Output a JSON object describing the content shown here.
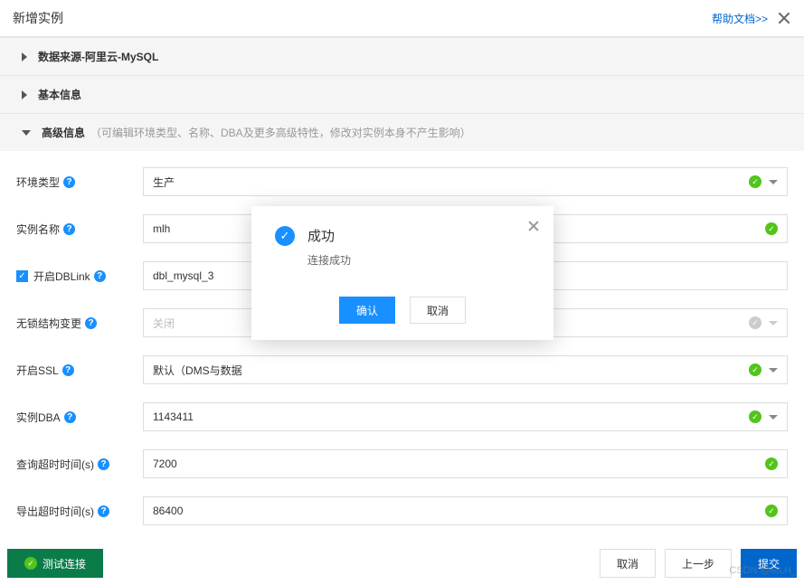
{
  "header": {
    "title": "新增实例",
    "help_link": "帮助文档>>"
  },
  "sections": {
    "datasource": {
      "label": "数据来源-阿里云-MySQL"
    },
    "basic": {
      "label": "基本信息"
    },
    "advanced": {
      "label": "高级信息",
      "sub": "（可编辑环境类型、名称、DBA及更多高级特性，修改对实例本身不产生影响）"
    }
  },
  "form": {
    "env_type": {
      "label": "环境类型",
      "value": "生产"
    },
    "instance_name": {
      "label": "实例名称",
      "value": "mlh"
    },
    "dblink": {
      "label": "开启DBLink",
      "value": "dbl_mysql_3"
    },
    "lockfree": {
      "label": "无锁结构变更",
      "value": "关闭"
    },
    "ssl": {
      "label": "开启SSL",
      "value": "默认（DMS与数据"
    },
    "dba": {
      "label": "实例DBA",
      "value": "1143411"
    },
    "query_timeout": {
      "label": "查询超时时间(s)",
      "value": "7200"
    },
    "export_timeout": {
      "label": "导出超时时间(s)",
      "value": "86400"
    }
  },
  "footer": {
    "test": "测试连接",
    "cancel": "取消",
    "prev": "上一步",
    "submit": "提交"
  },
  "modal": {
    "title": "成功",
    "message": "连接成功",
    "ok": "确认",
    "cancel": "取消"
  },
  "watermark": "CSDN @MLH_"
}
